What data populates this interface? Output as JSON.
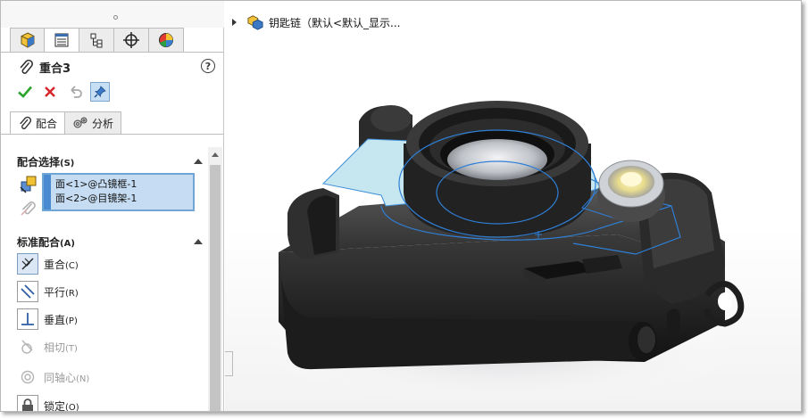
{
  "property_manager": {
    "tabs": [
      "feature-manager",
      "property-manager",
      "configuration-manager",
      "dimxpert-manager",
      "display-manager"
    ],
    "title": "重合3",
    "help_label": "?",
    "sub_tabs": [
      {
        "label": "配合",
        "active": true
      },
      {
        "label": "分析",
        "active": false
      }
    ],
    "mate_selections": {
      "header": "配合选择",
      "header_key": "(S)",
      "items": [
        "面<1>@凸镜框-1",
        "面<2>@目镜架-1"
      ]
    },
    "standard_mates": {
      "header": "标准配合",
      "header_key": "(A)",
      "items": [
        {
          "label": "重合",
          "key": "(C)",
          "enabled": true,
          "selected": true
        },
        {
          "label": "平行",
          "key": "(R)",
          "enabled": true,
          "selected": false
        },
        {
          "label": "垂直",
          "key": "(P)",
          "enabled": true,
          "selected": false
        },
        {
          "label": "相切",
          "key": "(T)",
          "enabled": false,
          "selected": false
        },
        {
          "label": "同轴心",
          "key": "(N)",
          "enabled": false,
          "selected": false
        },
        {
          "label": "锁定",
          "key": "(O)",
          "enabled": true,
          "selected": false
        }
      ]
    }
  },
  "graphics": {
    "tree_label": "钥匙链（默认<默认_显示..."
  },
  "colors": {
    "accent_blue": "#4a8ad1",
    "selection_fill": "#c5dcf2",
    "confirm_green": "#2aa42a",
    "cancel_red": "#d8232a"
  }
}
